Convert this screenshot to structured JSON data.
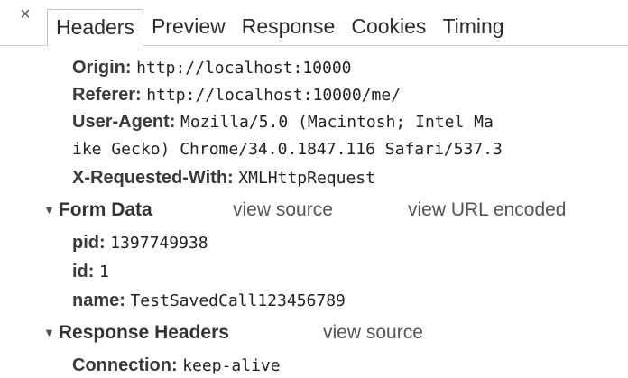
{
  "tabs": {
    "close_symbol": "×",
    "items": [
      "Headers",
      "Preview",
      "Response",
      "Cookies",
      "Timing"
    ]
  },
  "request_headers": [
    {
      "key": "Origin:",
      "value": "http://localhost:10000"
    },
    {
      "key": "Referer:",
      "value": "http://localhost:10000/me/"
    },
    {
      "key": "User-Agent:",
      "value": "Mozilla/5.0 (Macintosh; Intel Ma"
    },
    {
      "continuation": "ike Gecko) Chrome/34.0.1847.116 Safari/537.3"
    },
    {
      "key": "X-Requested-With:",
      "value": "XMLHttpRequest"
    }
  ],
  "form_data": {
    "title": "Form Data",
    "view_source": "view source",
    "view_url_encoded": "view URL encoded",
    "rows": [
      {
        "key": "pid:",
        "value": "1397749938"
      },
      {
        "key": "id:",
        "value": "1"
      },
      {
        "key": "name:",
        "value": "TestSavedCall123456789"
      }
    ]
  },
  "response_headers": {
    "title": "Response Headers",
    "view_source": "view source",
    "rows": [
      {
        "key": "Connection:",
        "value": "keep-alive"
      }
    ]
  }
}
